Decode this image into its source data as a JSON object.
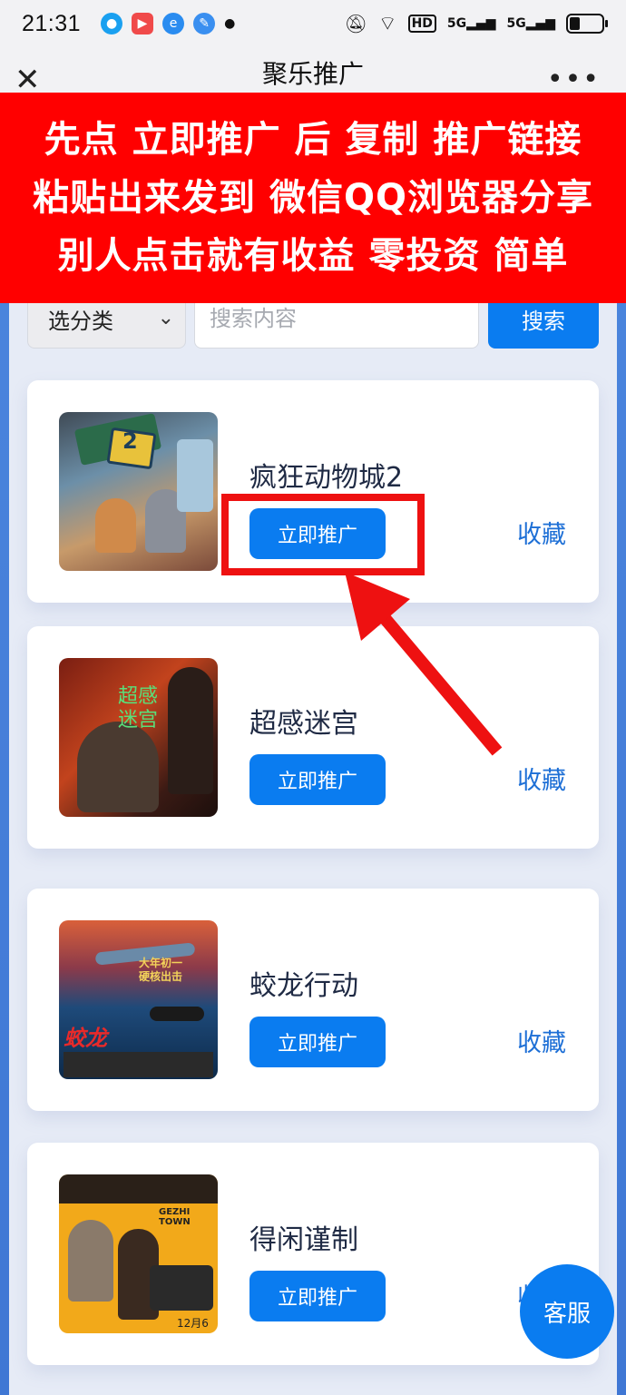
{
  "status_bar": {
    "time": "21:31",
    "network_1": "5G",
    "network_2": "5G",
    "hd_badge": "HD"
  },
  "title_bar": {
    "title": "聚乐推广",
    "close_icon": "close-icon",
    "more_icon": "more-icon"
  },
  "banner": {
    "lines": [
      "先点 立即推广 后 复制 推广链接",
      "粘贴出来发到 微信QQ浏览器分享",
      "别人点击就有收益 零投资 简单"
    ]
  },
  "search": {
    "category_label": "选分类",
    "placeholder": "搜索内容",
    "button_label": "搜索"
  },
  "movies": [
    {
      "title": "疯狂动物城2",
      "promote_label": "立即推广",
      "favorite_label": "收藏"
    },
    {
      "title": "超感迷宫",
      "promote_label": "立即推广",
      "favorite_label": "收藏"
    },
    {
      "title": "蛟龙行动",
      "promote_label": "立即推广",
      "favorite_label": "收藏"
    },
    {
      "title": "得闲谨制",
      "promote_label": "立即推广",
      "favorite_label": "收藏"
    }
  ],
  "posters": {
    "p1_text": "2",
    "p2_text": "超感\n迷宫",
    "p3_text": "大年初一\n硬核出击",
    "p4_text": "GEZHI TOWN",
    "p4_date": "12月6日"
  },
  "service_button": {
    "label": "客服"
  },
  "colors": {
    "accent": "#0a7cf0",
    "banner": "#ff0000",
    "highlight": "#ee1111"
  }
}
